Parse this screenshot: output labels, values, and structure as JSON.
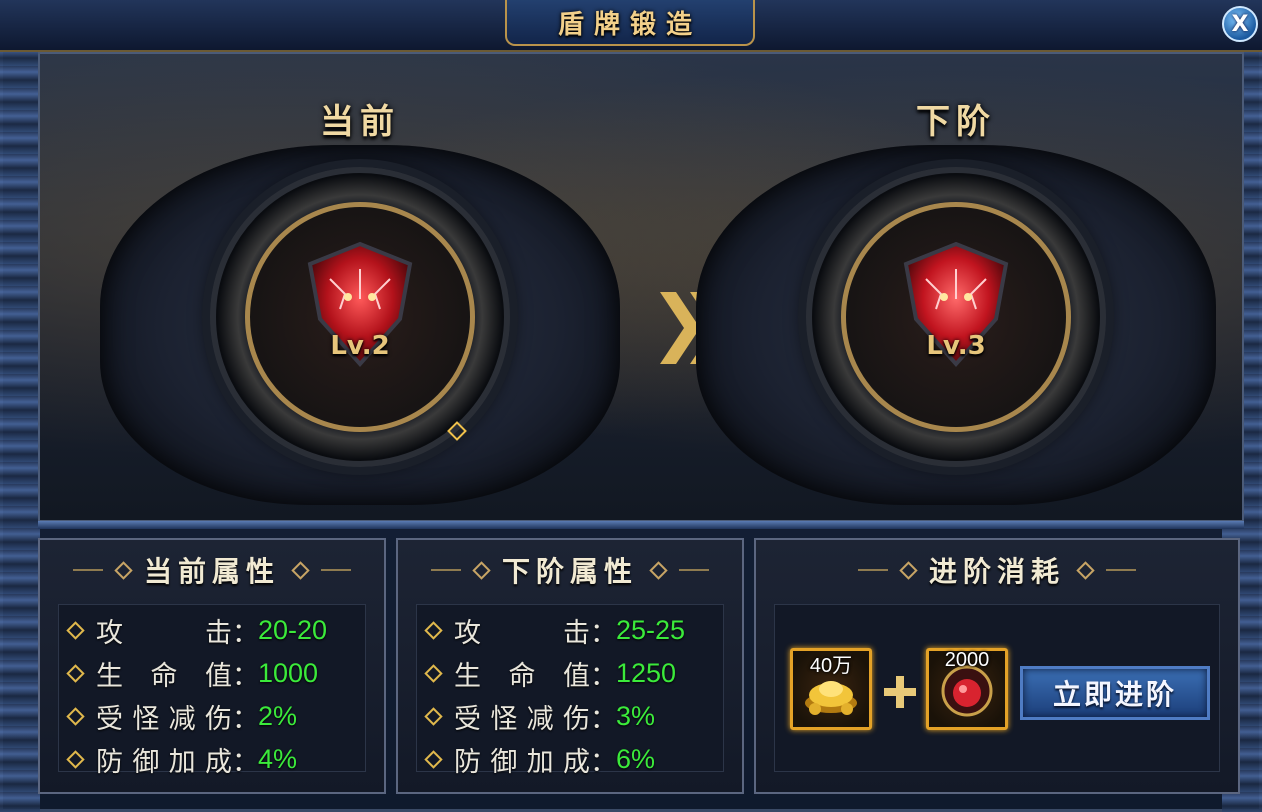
{
  "window": {
    "title": "盾牌锻造",
    "close_label": "X"
  },
  "current": {
    "label": "当前",
    "level": "Lv.2"
  },
  "next": {
    "label": "下阶",
    "level": "Lv.3"
  },
  "current_panel": {
    "title": "当前属性",
    "attributes": [
      {
        "name": "攻击",
        "value": "20-20"
      },
      {
        "name": "生命值",
        "value": "1000"
      },
      {
        "name": "受怪减伤",
        "value": "2%"
      },
      {
        "name": "防御加成",
        "value": "4%"
      }
    ]
  },
  "next_panel": {
    "title": "下阶属性",
    "attributes": [
      {
        "name": "攻击",
        "value": "25-25"
      },
      {
        "name": "生命值",
        "value": "1250"
      },
      {
        "name": "受怪减伤",
        "value": "3%"
      },
      {
        "name": "防御加成",
        "value": "6%"
      }
    ]
  },
  "cost_panel": {
    "title": "进阶消耗",
    "items": [
      {
        "icon": "gold-ingot-icon",
        "amount": "40万"
      },
      {
        "icon": "red-gem-icon",
        "amount": "2000"
      }
    ],
    "button_label": "立即进阶"
  },
  "colors": {
    "gold": "#e7c57b",
    "value_green": "#3bea3b",
    "button_blue": "#2e5ea0"
  }
}
